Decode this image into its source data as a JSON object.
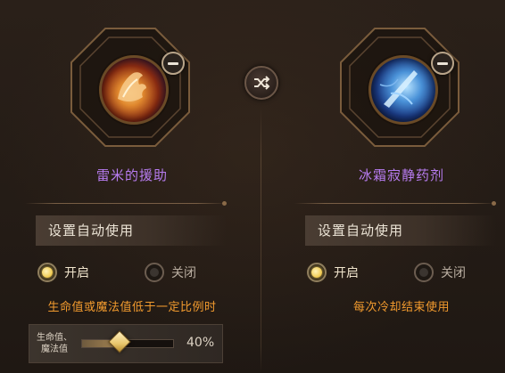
{
  "colors": {
    "item_name": "#b77cf0",
    "condition_text": "#f19a2e",
    "radio_active": "#f2cf5b"
  },
  "swap": {
    "icon": "shuffle-icon"
  },
  "left_panel": {
    "item_name": "雷米的援助",
    "item_icon": "flame-hand-icon",
    "auto_use_header": "设置自动使用",
    "on_label": "开启",
    "off_label": "关闭",
    "selected": "on",
    "condition": "生命值或魔法值低于一定比例时",
    "slider": {
      "label_line1": "生命值、",
      "label_line2": "魔法值",
      "value": 0.4,
      "value_text": "40%"
    }
  },
  "right_panel": {
    "item_name": "冰霜寂静药剂",
    "item_icon": "ice-blade-icon",
    "auto_use_header": "设置自动使用",
    "on_label": "开启",
    "off_label": "关闭",
    "selected": "on",
    "condition": "每次冷却结束使用"
  }
}
